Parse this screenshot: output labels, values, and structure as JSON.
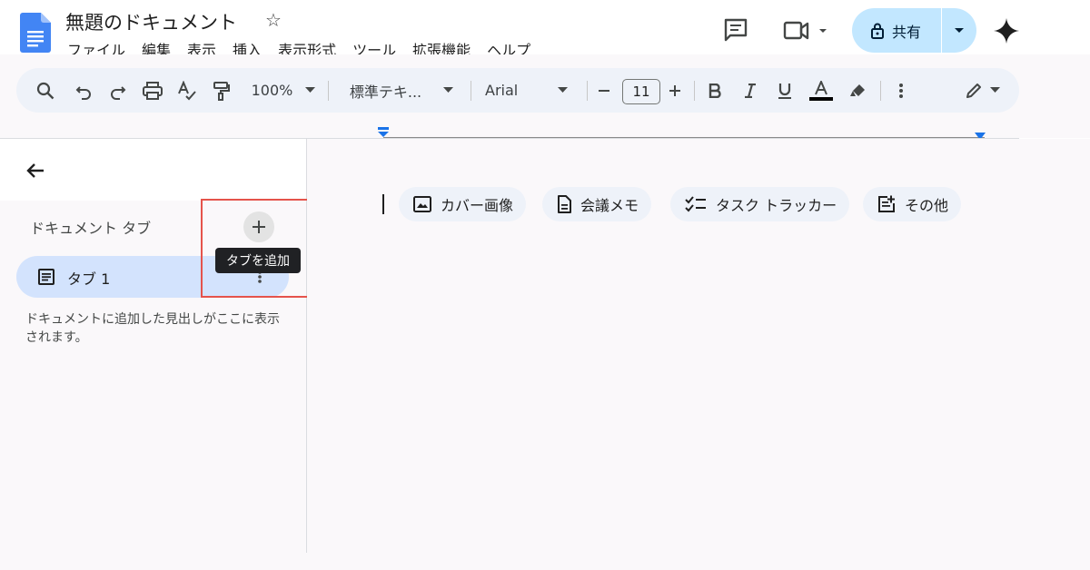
{
  "app": {
    "doc_title": "無題のドキュメント",
    "menu": [
      "ファイル",
      "編集",
      "表示",
      "挿入",
      "表示形式",
      "ツール",
      "拡張機能",
      "ヘルプ"
    ],
    "share_label": "共有",
    "colors": {
      "brand_blue": "#4285f4",
      "share_bg": "#c2e7ff",
      "tab_active_bg": "#d3e3fd",
      "highlight_red": "#e5534b"
    }
  },
  "toolbar": {
    "zoom": "100%",
    "style": "標準テキ...",
    "font": "Arial",
    "font_size": "11",
    "icons": [
      "search-icon",
      "undo-icon",
      "redo-icon",
      "print-icon",
      "spellcheck-icon",
      "paint-format-icon",
      "bold-icon",
      "italic-icon",
      "underline-icon",
      "text-color-icon",
      "highlight-icon",
      "more-icon",
      "edit-mode-icon"
    ]
  },
  "sidebar": {
    "heading": "ドキュメント タブ",
    "add_tab_tooltip": "タブを追加",
    "tab_label": "タブ 1",
    "hint": "ドキュメントに追加した見出しがここに表示されます。"
  },
  "document": {
    "chips": [
      "カバー画像",
      "会議メモ",
      "タスク トラッカー",
      "その他"
    ]
  }
}
